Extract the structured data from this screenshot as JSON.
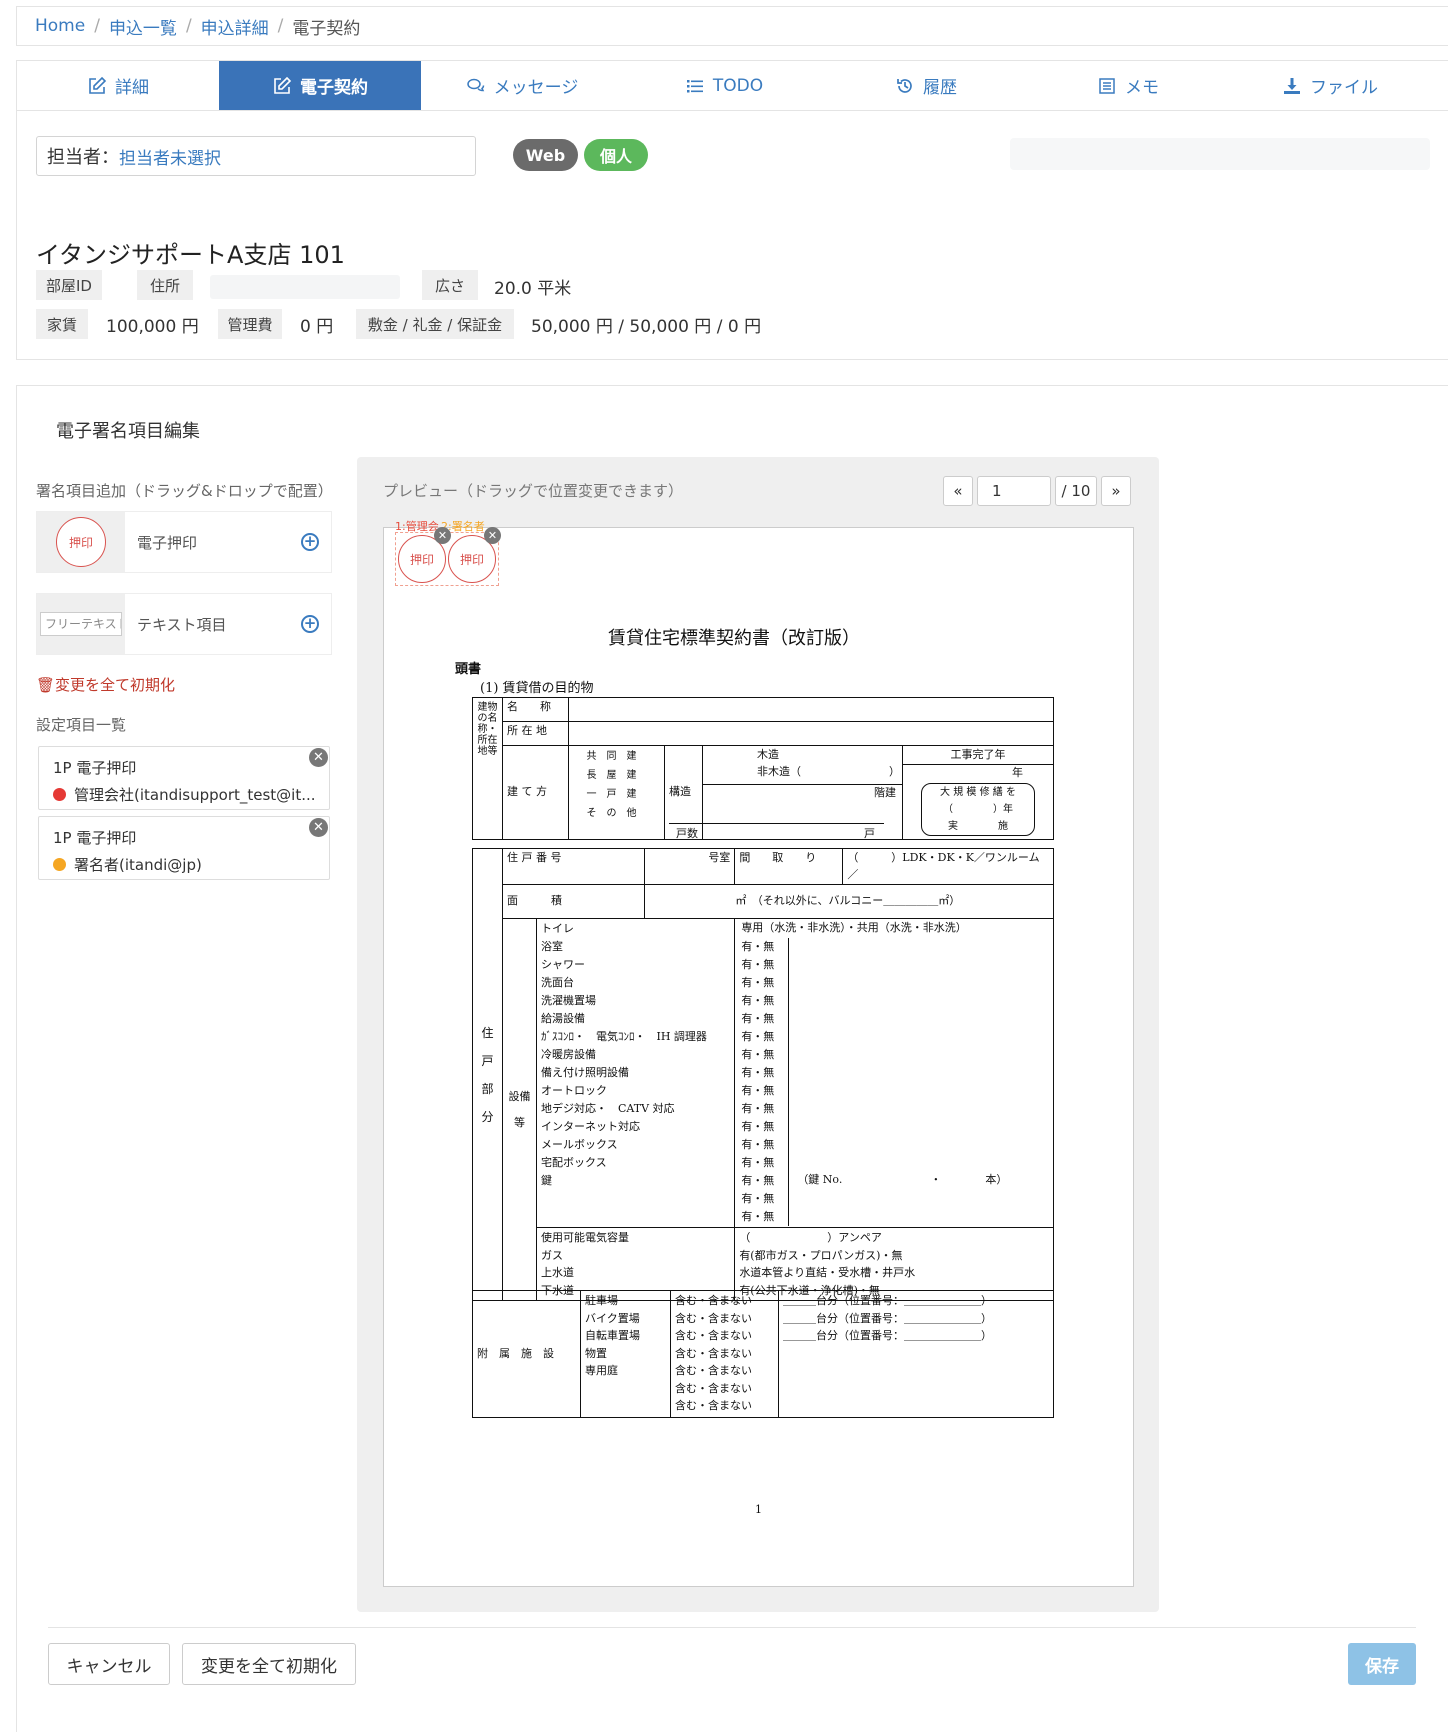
{
  "breadcrumb": [
    "Home",
    "申込一覧",
    "申込詳細",
    "電子契約"
  ],
  "tabs": [
    {
      "label": "詳細",
      "icon": "edit-icon"
    },
    {
      "label": "電子契約",
      "icon": "edit-icon",
      "active": true
    },
    {
      "label": "メッセージ",
      "icon": "chat-icon"
    },
    {
      "label": "TODO",
      "icon": "list-icon"
    },
    {
      "label": "履歴",
      "icon": "history-icon"
    },
    {
      "label": "メモ",
      "icon": "memo-icon"
    },
    {
      "label": "ファイル",
      "icon": "download-icon"
    }
  ],
  "assignee": {
    "label": "担当者：",
    "value": "担当者未選択"
  },
  "badges": {
    "web": "Web",
    "personal": "個人"
  },
  "property": {
    "title": "イタンジサポートA支店 101",
    "room_id_label": "部屋ID",
    "address_label": "住所",
    "area_label": "広さ",
    "area_value": "20.0 平米",
    "rent_label": "家賃",
    "rent_value": "100,000 円",
    "mgmt_label": "管理費",
    "mgmt_value": "0 円",
    "deposit_label": "敷金 / 礼金 / 保証金",
    "deposit_value": "50,000 円 / 50,000 円 / 0 円"
  },
  "editor": {
    "section_title": "電子署名項目編集",
    "add_label": "署名項目追加（ドラッグ&ドロップで配置）",
    "stamp_text": "押印",
    "stamp_item": "電子押印",
    "freetext_placeholder": "フリーテキスト",
    "text_item": "テキスト項目",
    "reset_link": "変更を全て初期化",
    "settings_label": "設定項目一覧",
    "settings": [
      {
        "title": "1P 電子押印",
        "who": "管理会社(itandisupport_test@it...",
        "color": "#e53935"
      },
      {
        "title": "1P 電子押印",
        "who": "署名者(itandi@jp)",
        "color": "#f5a623"
      }
    ]
  },
  "preview": {
    "label": "プレビュー（ドラッグで位置変更できます）",
    "first": "«",
    "page": "1",
    "total": "/ 10",
    "last": "»",
    "overlay_label_1": "1:管理会",
    "overlay_label_2": "2:署名者",
    "stamp_text": "押印"
  },
  "document": {
    "title": "賃貸住宅標準契約書（改訂版）",
    "heading": "頭書",
    "subheading": "(1)  賃貸借の目的物",
    "page_number": "1",
    "row_name": "名　　称",
    "row_address": "所 在 地",
    "side_building": "建物の名称・所在地等",
    "build_type": "建 て 方",
    "build_types": [
      "共",
      "同",
      "建",
      "長",
      "屋",
      "建",
      "一",
      "戸",
      "建",
      "そ",
      "の",
      "他"
    ],
    "structure_label": "構造",
    "wood": "木造",
    "nonwood": "非木造（　　　　　　　　）",
    "floors": "階建",
    "units_label": "戸数",
    "units": "戸",
    "completion": "工事完了年",
    "year": "年",
    "renovation": "大 規 模 修 繕 を",
    "renovation2": "（　　　　）年",
    "renovation3": "実　　　　施",
    "unit_no": "住 戸 番 号",
    "room": "号室",
    "layout": "間　　取　　り",
    "layout_value": "（　　　）LDK・DK・K／ワンルーム／",
    "area_label": "面　　　積",
    "area_value": "㎡　（それ以外に、バルコニー＿＿＿＿＿㎡）",
    "side_unit": "住戸部分",
    "side_equip": "設備等",
    "equip_header": "専用（水洗・非水洗）・共用（水洗・非水洗）",
    "equipment": [
      "トイレ",
      "浴室",
      "シャワー",
      "洗面台",
      "洗濯機置場",
      "給湯設備",
      "ｶﾞｽｺﾝﾛ・　電気ｺﾝﾛ・　IH 調理器",
      "冷暖房設備",
      "備え付け照明設備",
      "オートロック",
      "地デジ対応・　CATV 対応",
      "インターネット対応",
      "メールボックス",
      "宅配ボックス",
      "鍵"
    ],
    "has_none": "有・無",
    "key_note": "（鍵 No.　　　　　　　　・　　　　本）",
    "utilities": [
      "使用可能電気容量",
      "ガス",
      "上水道",
      "下水道"
    ],
    "utility_values": [
      "（　　　　　　　）アンペア",
      "有(都市ガス・プロパンガス)・無",
      "水道本管より直結・受水槽・井戸水",
      "有(公共下水道・浄化槽)・無"
    ],
    "side_attached": "附　属　施　設",
    "facilities": [
      "駐車場",
      "バイク置場",
      "自転車置場",
      "物置",
      "専用庭"
    ],
    "include": "含む・含まない",
    "slot": "＿＿＿台分（位置番号：＿＿＿＿＿＿＿）"
  },
  "footer": {
    "cancel": "キャンセル",
    "reset": "変更を全て初期化",
    "save": "保存"
  }
}
